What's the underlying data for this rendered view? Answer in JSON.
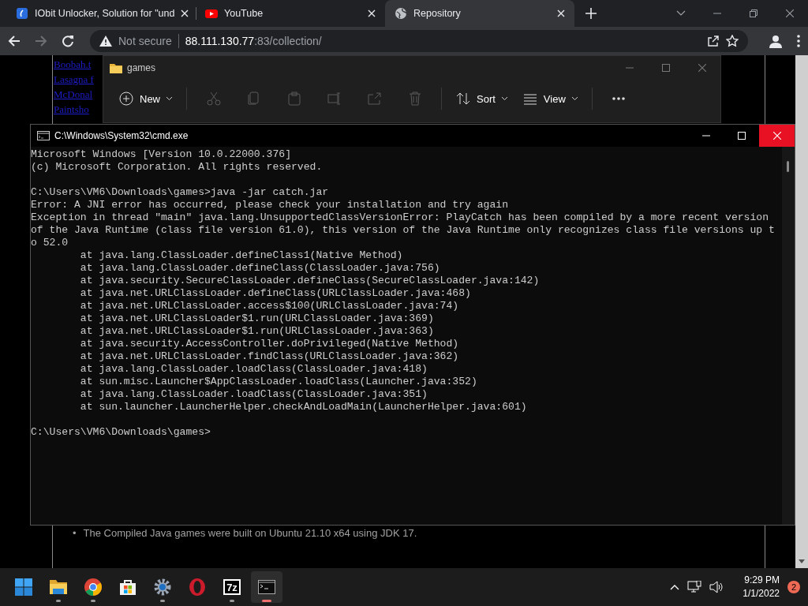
{
  "browser": {
    "tabs": [
      {
        "title": "IObit Unlocker, Solution for \"und",
        "kind": "iobit",
        "selected": false
      },
      {
        "title": "YouTube",
        "kind": "video",
        "selected": false
      },
      {
        "title": "Repository",
        "kind": "globe",
        "selected": true
      }
    ],
    "address": {
      "security": "Not secure",
      "host": "88.111.130.77",
      "path": ":83/collection/"
    }
  },
  "web_page": {
    "links": [
      "Boobah.t",
      "Lasagna f",
      "McDonal",
      "Paintsho"
    ],
    "bullets": [
      {
        "marker": "•",
        "text": "The Compiled Java games were built on Ubuntu 21.10 x64 using JDK 17."
      }
    ]
  },
  "explorer": {
    "title": "games",
    "toolbar": [
      {
        "kind": "new",
        "label": "New",
        "disabled": false
      },
      {
        "kind": "cut",
        "disabled": true
      },
      {
        "kind": "copy",
        "disabled": true
      },
      {
        "kind": "paste",
        "disabled": true
      },
      {
        "kind": "rename",
        "disabled": true
      },
      {
        "kind": "share",
        "disabled": true
      },
      {
        "kind": "delete",
        "disabled": true
      },
      {
        "kind": "sort",
        "label": "Sort",
        "disabled": false
      },
      {
        "kind": "view",
        "label": "View",
        "disabled": false
      },
      {
        "kind": "more",
        "disabled": false
      }
    ]
  },
  "console": {
    "title": "C:\\Windows\\System32\\cmd.exe",
    "lines": [
      "Microsoft Windows [Version 10.0.22000.376]",
      "(c) Microsoft Corporation. All rights reserved.",
      {
        "text": "C:\\Users\\VM6\\Downloads\\games>java -jar catch.jar",
        "gap_before": true
      },
      "Error: A JNI error has occurred, please check your installation and try again",
      "Exception in thread \"main\" java.lang.UnsupportedClassVersionError: PlayCatch has been compiled by a more recent version",
      "of the Java Runtime (class file version 61.0), this version of the Java Runtime only recognizes class file versions up t",
      "o 52.0",
      "        at java.lang.ClassLoader.defineClass1(Native Method)",
      "        at java.lang.ClassLoader.defineClass(ClassLoader.java:756)",
      "        at java.security.SecureClassLoader.defineClass(SecureClassLoader.java:142)",
      "        at java.net.URLClassLoader.defineClass(URLClassLoader.java:468)",
      "        at java.net.URLClassLoader.access$100(URLClassLoader.java:74)",
      "        at java.net.URLClassLoader$1.run(URLClassLoader.java:369)",
      "        at java.net.URLClassLoader$1.run(URLClassLoader.java:363)",
      "        at java.security.AccessController.doPrivileged(Native Method)",
      "        at java.net.URLClassLoader.findClass(URLClassLoader.java:362)",
      "        at java.lang.ClassLoader.loadClass(ClassLoader.java:418)",
      "        at sun.misc.Launcher$AppClassLoader.loadClass(Launcher.java:352)",
      "        at java.lang.ClassLoader.loadClass(ClassLoader.java:351)",
      "        at sun.launcher.LauncherHelper.checkAndLoadMain(LauncherHelper.java:601)",
      {
        "text": "C:\\Users\\VM6\\Downloads\\games>",
        "gap_before": true
      }
    ]
  },
  "taskbar": {
    "apps": [
      {
        "kind": "start",
        "running": false,
        "selected": false
      },
      {
        "kind": "folder",
        "running": true,
        "selected": false
      },
      {
        "kind": "chrome",
        "running": true,
        "selected": false
      },
      {
        "kind": "store",
        "running": false,
        "selected": false
      },
      {
        "kind": "settings",
        "running": true,
        "selected": false
      },
      {
        "kind": "opera",
        "running": false,
        "selected": false
      },
      {
        "kind": "archiver",
        "label": "7z",
        "running": true,
        "selected": false
      },
      {
        "kind": "terminal",
        "running": true,
        "selected": true
      }
    ],
    "time": "9:29 PM",
    "date": "1/1/2022",
    "notifications": "2"
  }
}
